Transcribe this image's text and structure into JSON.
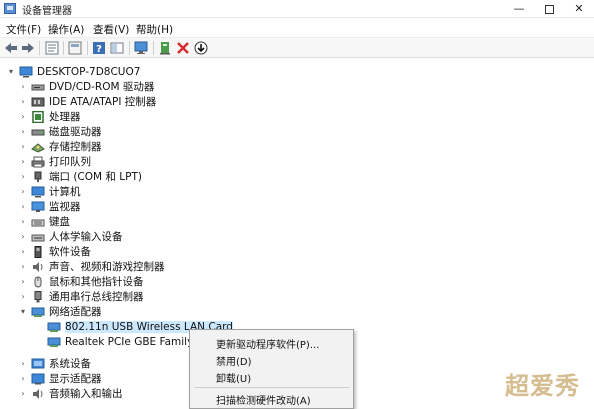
{
  "window": {
    "title": "设备管理器",
    "min_glyph": "—",
    "close_glyph": "✕"
  },
  "menu": [
    "文件(F)",
    "操作(A)",
    "查看(V)",
    "帮助(H)"
  ],
  "toolbar": {
    "buttons": [
      "back-icon",
      "forward-icon",
      "properties-icon",
      "show-hidden-icon",
      "help-icon",
      "view-icon",
      "monitor-icon",
      "update-driver-icon",
      "uninstall-icon",
      "scan-icon"
    ]
  },
  "tree": {
    "root": "DESKTOP-7D8CUO7",
    "categories": [
      {
        "label": "DVD/CD-ROM 驱动器",
        "icon": "dvd-drive-icon",
        "expanded": false
      },
      {
        "label": "IDE ATA/ATAPI 控制器",
        "icon": "ide-controller-icon",
        "expanded": false
      },
      {
        "label": "处理器",
        "icon": "processor-icon",
        "expanded": false
      },
      {
        "label": "磁盘驱动器",
        "icon": "disk-drive-icon",
        "expanded": false
      },
      {
        "label": "存储控制器",
        "icon": "storage-controller-icon",
        "expanded": false
      },
      {
        "label": "打印队列",
        "icon": "printer-icon",
        "expanded": false
      },
      {
        "label": "端口 (COM 和 LPT)",
        "icon": "port-icon",
        "expanded": false
      },
      {
        "label": "计算机",
        "icon": "computer-icon",
        "expanded": false
      },
      {
        "label": "监视器",
        "icon": "monitor-icon",
        "expanded": false
      },
      {
        "label": "键盘",
        "icon": "keyboard-icon",
        "expanded": false
      },
      {
        "label": "人体学输入设备",
        "icon": "hid-icon",
        "expanded": false
      },
      {
        "label": "软件设备",
        "icon": "software-device-icon",
        "expanded": false
      },
      {
        "label": "声音、视频和游戏控制器",
        "icon": "sound-icon",
        "expanded": false
      },
      {
        "label": "鼠标和其他指针设备",
        "icon": "mouse-icon",
        "expanded": false
      },
      {
        "label": "通用串行总线控制器",
        "icon": "usb-icon",
        "expanded": false
      },
      {
        "label": "网络适配器",
        "icon": "network-adapter-icon",
        "expanded": true
      },
      {
        "label": "系统设备",
        "icon": "system-device-icon",
        "expanded": false
      },
      {
        "label": "显示适配器",
        "icon": "display-adapter-icon",
        "expanded": false
      },
      {
        "label": "音频输入和输出",
        "icon": "audio-io-icon",
        "expanded": false
      }
    ],
    "network_children": [
      {
        "label": "802.11n USB Wireless LAN Card",
        "selected": true
      },
      {
        "label": "Realtek PCIe GBE Family Controller",
        "selected": false
      }
    ]
  },
  "context_menu": {
    "items": [
      "更新驱动程序软件(P)...",
      "禁用(D)",
      "卸载(U)",
      "扫描检测硬件改动(A)"
    ]
  },
  "watermark": "超爱秀",
  "colors": {
    "selection": "#cce8ff",
    "accent": "#0078d7",
    "uninstall_red": "#d42a2a"
  }
}
